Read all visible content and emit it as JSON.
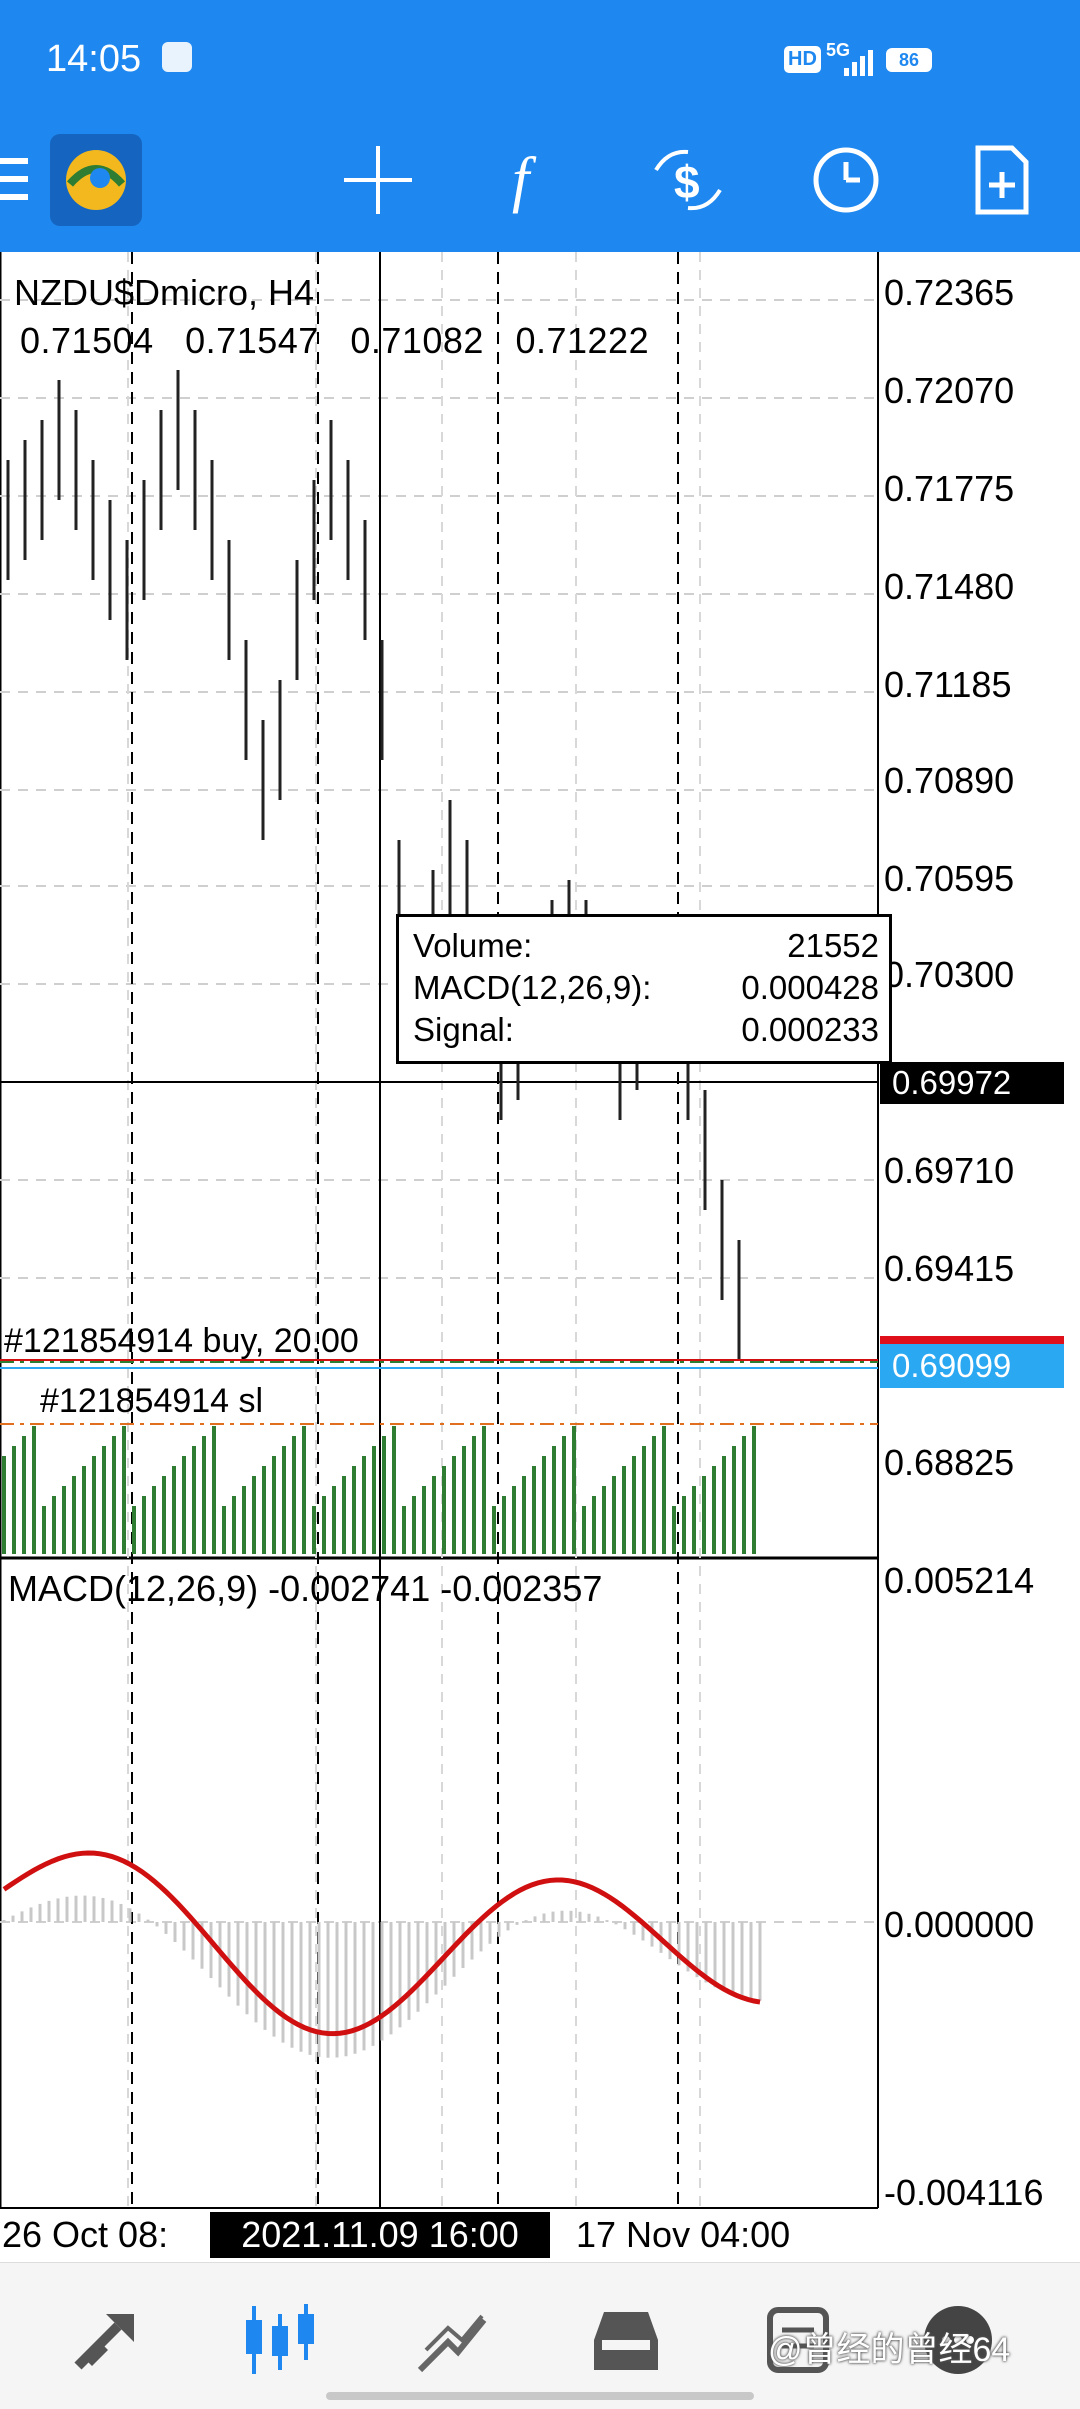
{
  "status_bar": {
    "time": "14:05",
    "network_badge": "HD",
    "network": "5G",
    "battery": "86"
  },
  "toolbar": {
    "icons": [
      "menu-icon",
      "mt4-logo-icon",
      "crosshair-icon",
      "indicator-f-icon",
      "dollar-sync-icon",
      "clock-icon",
      "new-order-icon"
    ]
  },
  "chart": {
    "symbol_title": "NZDU$Dmicro,  H4",
    "ohlc": [
      "0.71504",
      "0.71547",
      "0.71082",
      "0.71222"
    ],
    "price_axis": [
      "0.72365",
      "0.72070",
      "0.71775",
      "0.71480",
      "0.71185",
      "0.70890",
      "0.70595",
      "0.70300",
      "0.69710",
      "0.69415",
      "0.68825"
    ],
    "current_price": "0.69972",
    "bid_price": "0.69099",
    "tooltip": {
      "rows": [
        {
          "k": "Volume:",
          "v": "21552"
        },
        {
          "k": "MACD(12,26,9):",
          "v": "0.000428"
        },
        {
          "k": "Signal:",
          "v": "0.000233"
        }
      ]
    },
    "order_buy": "#121854914  buy, 20.00",
    "order_sl": "#121854914  sl",
    "macd_title": "MACD(12,26,9)  -0.002741  -0.002357",
    "macd_axis": [
      "0.005214",
      "0.000000",
      "-0.004116"
    ],
    "time_axis": {
      "left": "26  Oct  08:",
      "highlight": "2021.11.09  16:00",
      "right": "17  Nov  04:00"
    },
    "colors": {
      "up_bar": "#2e7d32",
      "signal_line": "#d01010",
      "buy_line": "#2e7d32",
      "sl_line": "#e07020",
      "accent": "#1e88f0"
    }
  },
  "bottom_nav": {
    "icons": [
      "quotes-icon",
      "chart-icon",
      "trade-icon",
      "history-icon",
      "messages-icon",
      "chat-icon"
    ],
    "watermark": "@曾经的曾经64"
  }
}
